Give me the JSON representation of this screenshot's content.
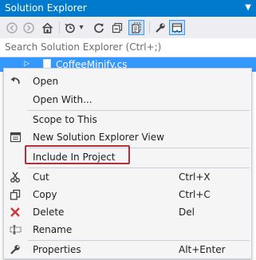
{
  "title": "Solution Explorer",
  "pin_glyph": "▼",
  "toolbar": {
    "icons": [
      "back-icon",
      "forward-icon",
      "home-icon",
      "history-icon",
      "sync-icon",
      "collapse-all-icon",
      "show-all-files-icon",
      "properties-icon",
      "preview-icon"
    ],
    "chevron": "▾"
  },
  "search": {
    "placeholder": "Search Solution Explorer (Ctrl+;)"
  },
  "tree": {
    "selected_item": "CoffeeMinify.cs"
  },
  "menu": {
    "items": [
      {
        "label": "Open",
        "shortcut": "",
        "icon": "open-icon"
      },
      {
        "label": "Open With...",
        "shortcut": "",
        "icon": ""
      },
      {
        "label": "Scope to This",
        "shortcut": "",
        "icon": ""
      },
      {
        "label": "New Solution Explorer View",
        "shortcut": "",
        "icon": "new-view-icon"
      },
      {
        "label": "Include In Project",
        "shortcut": "",
        "icon": ""
      },
      {
        "label": "Cut",
        "shortcut": "Ctrl+X",
        "icon": "cut-icon"
      },
      {
        "label": "Copy",
        "shortcut": "Ctrl+C",
        "icon": "copy-icon"
      },
      {
        "label": "Delete",
        "shortcut": "Del",
        "icon": "delete-icon"
      },
      {
        "label": "Rename",
        "shortcut": "",
        "icon": "rename-icon"
      },
      {
        "label": "Properties",
        "shortcut": "Alt+Enter",
        "icon": "properties-icon"
      }
    ]
  },
  "colors": {
    "accent": "#007acc",
    "selection": "#3399ff",
    "highlight_box": "#b3303a",
    "delete_icon": "#d13438"
  }
}
